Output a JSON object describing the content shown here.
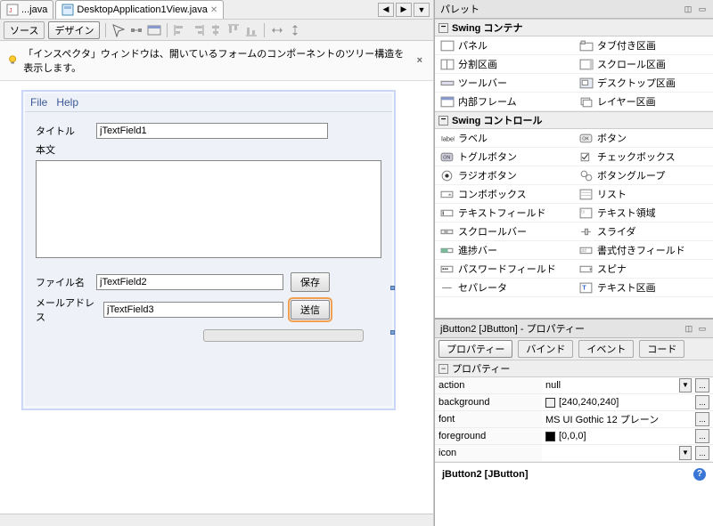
{
  "tabs": [
    {
      "label": "...java"
    },
    {
      "label": "DesktopApplication1View.java",
      "active": true
    }
  ],
  "toolbar": {
    "source": "ソース",
    "design": "デザイン"
  },
  "hint": {
    "text": "「インスペクタ」ウィンドウは、開いているフォームのコンポーネントのツリー構造を表示します。"
  },
  "form": {
    "menu": [
      "File",
      "Help"
    ],
    "labels": {
      "title": "タイトル",
      "body": "本文",
      "filename": "ファイル名",
      "email": "メールアドレス"
    },
    "fields": {
      "title": "jTextField1",
      "filename": "jTextField2",
      "email": "jTextField3"
    },
    "buttons": {
      "save": "保存",
      "send": "送信"
    }
  },
  "palette": {
    "title": "パレット",
    "categories": [
      {
        "name": "Swing コンテナ",
        "items": [
          {
            "label": "パネル",
            "icon": "panel"
          },
          {
            "label": "タブ付き区画",
            "icon": "tabbed"
          },
          {
            "label": "分割区画",
            "icon": "split"
          },
          {
            "label": "スクロール区画",
            "icon": "scroll"
          },
          {
            "label": "ツールバー",
            "icon": "toolbar"
          },
          {
            "label": "デスクトップ区画",
            "icon": "desktop"
          },
          {
            "label": "内部フレーム",
            "icon": "iframe"
          },
          {
            "label": "レイヤー区画",
            "icon": "layer"
          }
        ]
      },
      {
        "name": "Swing コントロール",
        "items": [
          {
            "label": "ラベル",
            "icon": "label"
          },
          {
            "label": "ボタン",
            "icon": "button"
          },
          {
            "label": "トグルボタン",
            "icon": "toggle"
          },
          {
            "label": "チェックボックス",
            "icon": "checkbox"
          },
          {
            "label": "ラジオボタン",
            "icon": "radio"
          },
          {
            "label": "ボタングループ",
            "icon": "group"
          },
          {
            "label": "コンボボックス",
            "icon": "combo"
          },
          {
            "label": "リスト",
            "icon": "list"
          },
          {
            "label": "テキストフィールド",
            "icon": "textfield"
          },
          {
            "label": "テキスト領域",
            "icon": "textarea"
          },
          {
            "label": "スクロールバー",
            "icon": "scrollbar"
          },
          {
            "label": "スライダ",
            "icon": "slider"
          },
          {
            "label": "進捗バー",
            "icon": "progress"
          },
          {
            "label": "書式付きフィールド",
            "icon": "fmtfield"
          },
          {
            "label": "パスワードフィールド",
            "icon": "password"
          },
          {
            "label": "スピナ",
            "icon": "spinner"
          },
          {
            "label": "セパレータ",
            "icon": "separator"
          },
          {
            "label": "テキスト区画",
            "icon": "textpane"
          }
        ]
      }
    ]
  },
  "properties": {
    "title": "jButton2 [JButton] - プロパティー",
    "tabs": [
      "プロパティー",
      "バインド",
      "イベント",
      "コード"
    ],
    "section": "プロパティー",
    "rows": [
      {
        "name": "action",
        "value": "null",
        "type": "combo"
      },
      {
        "name": "background",
        "value": "[240,240,240]",
        "swatch": "#f0f0f0"
      },
      {
        "name": "font",
        "value": "MS UI Gothic 12 プレーン"
      },
      {
        "name": "foreground",
        "value": "[0,0,0]",
        "swatch": "#000000"
      },
      {
        "name": "icon",
        "value": "",
        "type": "combo"
      }
    ]
  },
  "selection": {
    "label": "jButton2 [JButton]"
  }
}
